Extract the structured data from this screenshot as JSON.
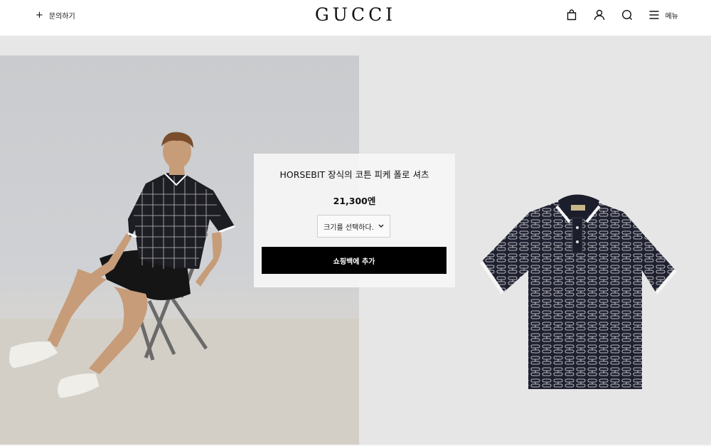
{
  "header": {
    "contact_label": "문의하기",
    "logo": "GUCCI",
    "menu_label": "메뉴",
    "icons": [
      "shopping-bag-icon",
      "account-icon",
      "search-icon",
      "menu-icon"
    ]
  },
  "product": {
    "title": "HORSEBIT 장식의 코튼 피케 폴로 셔츠",
    "price": "21,300엔",
    "size_placeholder": "크기를 선택하다.",
    "add_to_bag_label": "쇼핑백에 추가"
  },
  "colors": {
    "brand": "#111111",
    "button": "#000000",
    "background": "#e7e7e8"
  }
}
